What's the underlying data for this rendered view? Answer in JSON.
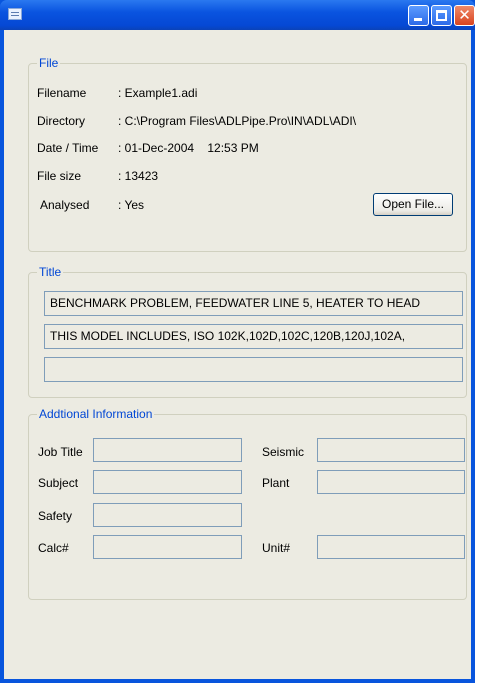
{
  "window": {
    "title": "",
    "icon": "app-window-icon",
    "controls": [
      "minimize-icon",
      "maximize-icon",
      "close-icon"
    ]
  },
  "file": {
    "legend": "File",
    "filename_label": "Filename",
    "filename_value": ": Example1.adi",
    "directory_label": "Directory",
    "directory_value": ": C:\\Program Files\\ADLPipe.Pro\\IN\\ADL\\ADI\\",
    "datetime_label": "Date / Time",
    "datetime_value": ": 01-Dec-2004    12:53 PM",
    "filesize_label": "File size",
    "filesize_value": ": 13423",
    "analysed_label": "Analysed",
    "analysed_value": ": Yes",
    "open_button": "Open File..."
  },
  "title_group": {
    "legend": "Title",
    "lines": [
      "BENCHMARK PROBLEM, FEEDWATER LINE 5, HEATER TO HEAD",
      "THIS MODEL INCLUDES, ISO 102K,102D,102C,120B,120J,102A,",
      ""
    ]
  },
  "additional": {
    "legend": "Addtional Information",
    "job_title_label": "Job Title",
    "job_title_value": "",
    "seismic_label": "Seismic",
    "seismic_value": "",
    "subject_label": "Subject",
    "subject_value": "",
    "plant_label": "Plant",
    "plant_value": "",
    "safety_label": "Safety",
    "safety_value": "",
    "calc_label": "Calc#",
    "calc_value": "",
    "unit_label": "Unit#",
    "unit_value": ""
  },
  "colors": {
    "titlebar": "#0548d4",
    "client": "#ecebe2",
    "legend_text": "#0046d5",
    "textbox_border": "#7f9db9"
  }
}
